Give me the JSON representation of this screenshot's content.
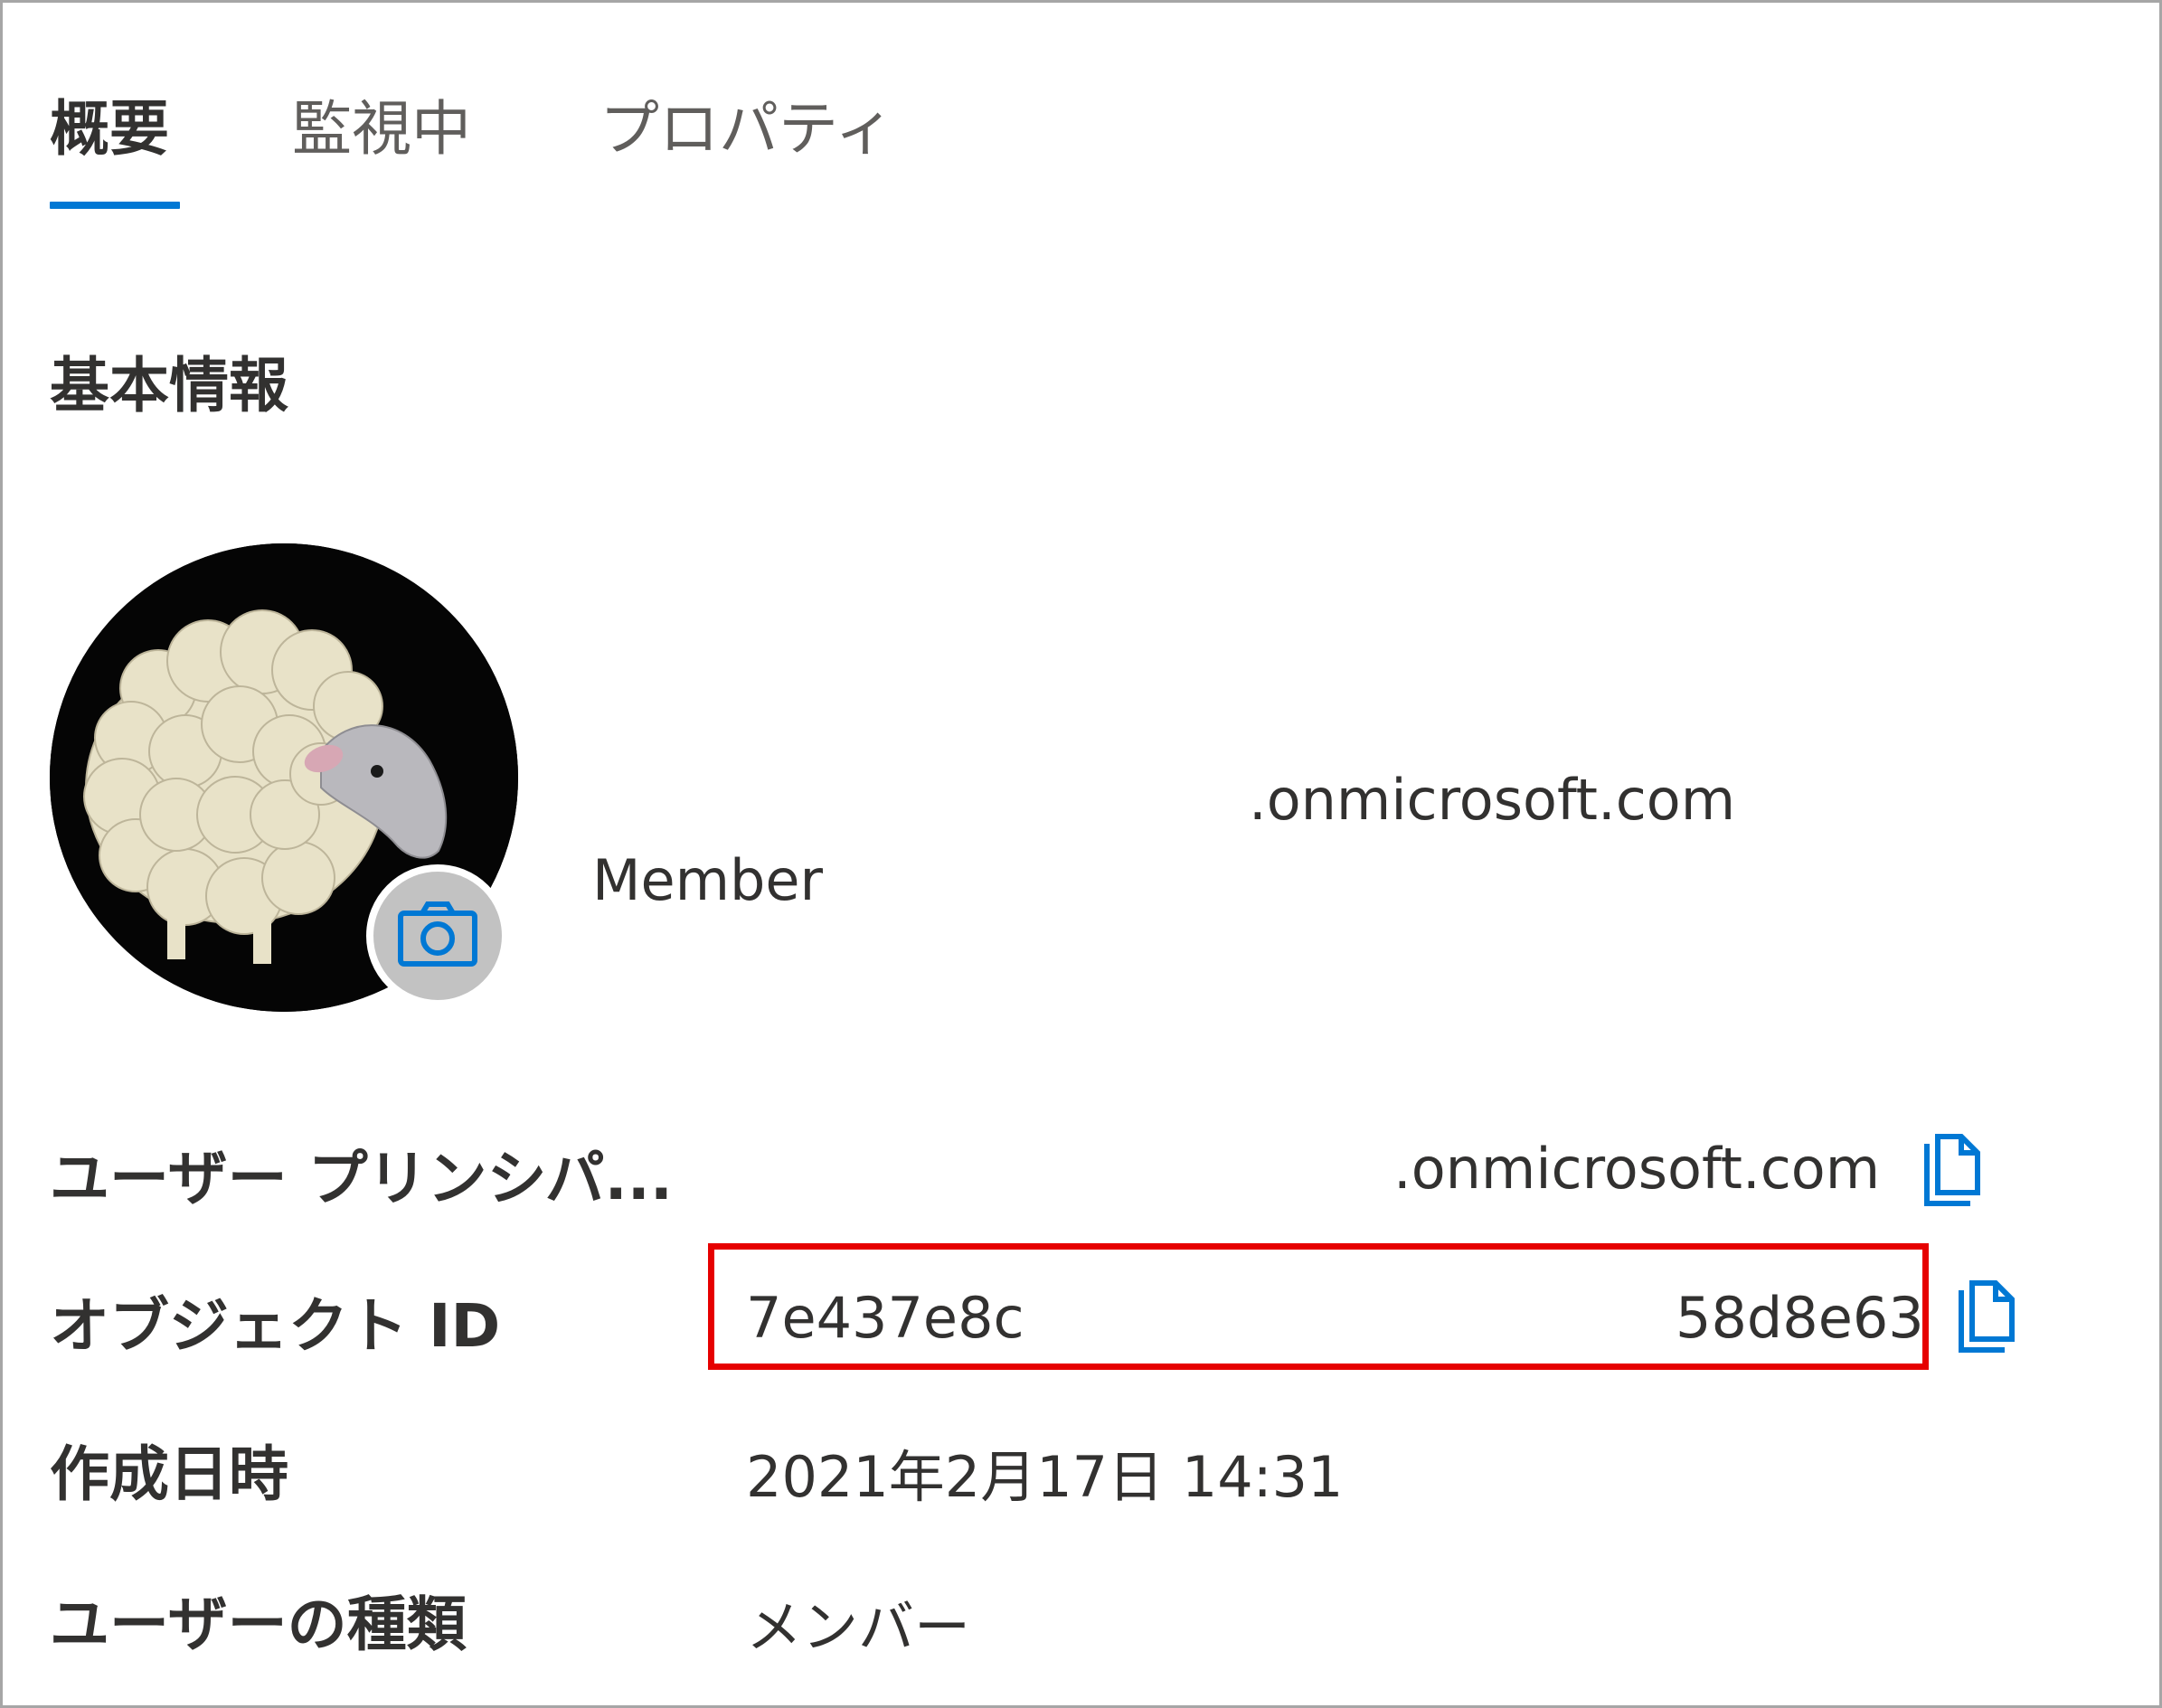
{
  "tabs": [
    {
      "label": "概要",
      "active": true
    },
    {
      "label": "監視中",
      "active": false
    },
    {
      "label": "プロパティ",
      "active": false
    }
  ],
  "section_heading": "基本情報",
  "profile": {
    "upn_partial": ".onmicrosoft.com",
    "member_label": "Member",
    "avatar_icon": "sheep-photo",
    "camera_icon": "camera-icon"
  },
  "details": {
    "upn": {
      "label": "ユーザー プリンシパ...",
      "value": ".onmicrosoft.com"
    },
    "object_id": {
      "label": "オブジェクト ID",
      "value_start": "7e437e8c",
      "value_end": "58d8e63"
    },
    "created": {
      "label": "作成日時",
      "value": "2021年2月17日 14:31"
    },
    "user_type": {
      "label": "ユーザーの種類",
      "value": "メンバー"
    }
  },
  "colors": {
    "accent": "#0078d4",
    "highlight": "#e60000",
    "text": "#323130"
  }
}
